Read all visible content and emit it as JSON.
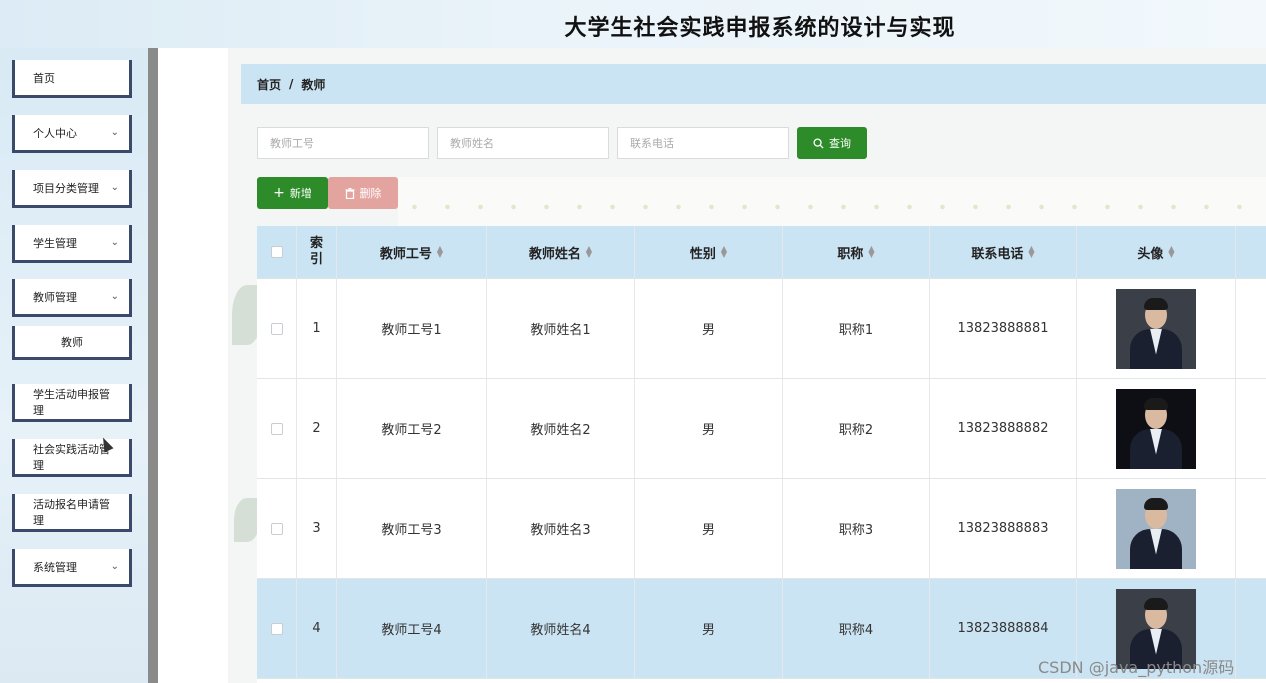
{
  "app": {
    "title": "大学生社会实践申报系统的设计与实现"
  },
  "sidebar": {
    "items": [
      {
        "label": "首页",
        "has_chevron": false
      },
      {
        "label": "个人中心",
        "has_chevron": true
      },
      {
        "label": "项目分类管理",
        "has_chevron": true
      },
      {
        "label": "学生管理",
        "has_chevron": true
      },
      {
        "label": "教师管理",
        "has_chevron": true
      },
      {
        "label": "教师",
        "is_sub": true
      },
      {
        "label": "学生活动申报管理",
        "has_chevron": false
      },
      {
        "label": "社会实践活动管理",
        "has_chevron": false
      },
      {
        "label": "活动报名申请管理",
        "has_chevron": false
      },
      {
        "label": "系统管理",
        "has_chevron": true
      }
    ],
    "chevron_glyph": "⌄"
  },
  "breadcrumb": {
    "home": "首页",
    "separator": "/",
    "current": "教师"
  },
  "search": {
    "teacher_no_placeholder": "教师工号",
    "teacher_name_placeholder": "教师姓名",
    "phone_placeholder": "联系电话",
    "query_label": "查询"
  },
  "actions": {
    "add_label": "新增",
    "delete_label": "删除"
  },
  "table": {
    "columns": {
      "index": "索引",
      "index_line1": "索",
      "index_line2": "引",
      "teacher_no": "教师工号",
      "teacher_name": "教师姓名",
      "gender": "性别",
      "title": "职称",
      "phone": "联系电话",
      "avatar": "头像"
    },
    "rows": [
      {
        "index": "1",
        "teacher_no": "教师工号1",
        "teacher_name": "教师姓名1",
        "gender": "男",
        "title": "职称1",
        "phone": "13823888881"
      },
      {
        "index": "2",
        "teacher_no": "教师工号2",
        "teacher_name": "教师姓名2",
        "gender": "男",
        "title": "职称2",
        "phone": "13823888882"
      },
      {
        "index": "3",
        "teacher_no": "教师工号3",
        "teacher_name": "教师姓名3",
        "gender": "男",
        "title": "职称3",
        "phone": "13823888883"
      },
      {
        "index": "4",
        "teacher_no": "教师工号4",
        "teacher_name": "教师姓名4",
        "gender": "男",
        "title": "职称4",
        "phone": "13823888884"
      }
    ]
  },
  "watermark": "CSDN @java_python源码",
  "colors": {
    "primary": "#2e8b2a",
    "danger": "#e3a4a0",
    "header_bg": "#cbe4f3",
    "sidebar_border": "#3b4a6b"
  }
}
